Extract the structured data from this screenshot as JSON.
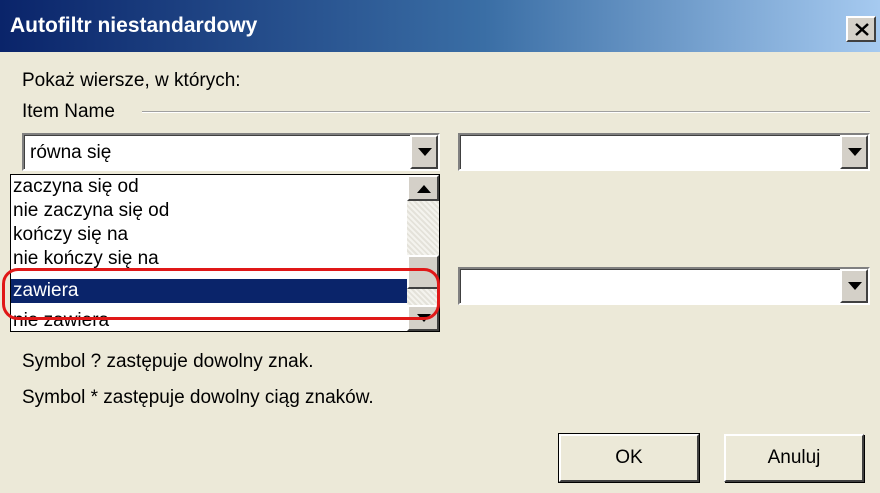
{
  "window": {
    "title": "Autofiltr niestandardowy",
    "close_icon": "close-icon"
  },
  "intro_label": "Pokaż wiersze, w których:",
  "field_group_label": "Item Name",
  "condition1": {
    "operator_value": "równa się",
    "value": ""
  },
  "operator_list": {
    "items": [
      "zaczyna się od",
      "nie zaczyna się od",
      "kończy się na",
      "nie kończy się na",
      "zawiera",
      "nie zawiera"
    ],
    "selected_index": 4,
    "selected_label": "zawiera"
  },
  "condition2": {
    "value": ""
  },
  "hints": {
    "line1": "Symbol ? zastępuje dowolny znak.",
    "line2": "Symbol * zastępuje dowolny ciąg znaków."
  },
  "buttons": {
    "ok": "OK",
    "cancel": "Anuluj"
  },
  "colors": {
    "titlebar_start": "#0a246a",
    "titlebar_end": "#a6caf0",
    "selection": "#0a246a",
    "annotation_ring": "#e01818",
    "dialog_bg": "#ece9d8"
  }
}
